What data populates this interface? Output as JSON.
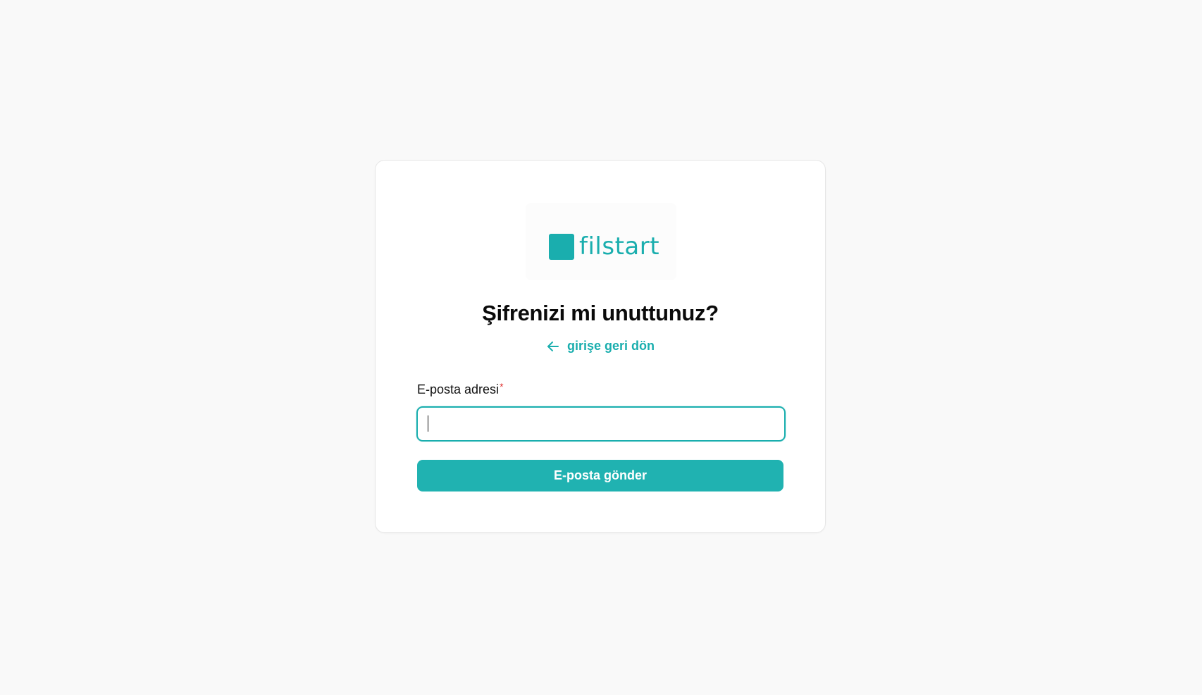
{
  "brand": {
    "name": "filstart",
    "color": "#1aaeae"
  },
  "page": {
    "title": "Şifrenizi mi unuttunuz?",
    "back_link_label": "girişe geri dön",
    "back_icon": "arrow-left-icon"
  },
  "form": {
    "email_label": "E-posta adresi",
    "required_marker": "*",
    "email_value": "",
    "email_placeholder": "",
    "submit_label": "E-posta gönder"
  },
  "colors": {
    "accent": "#20b2b1",
    "required": "#e0302f",
    "background": "#f9f9f9"
  }
}
